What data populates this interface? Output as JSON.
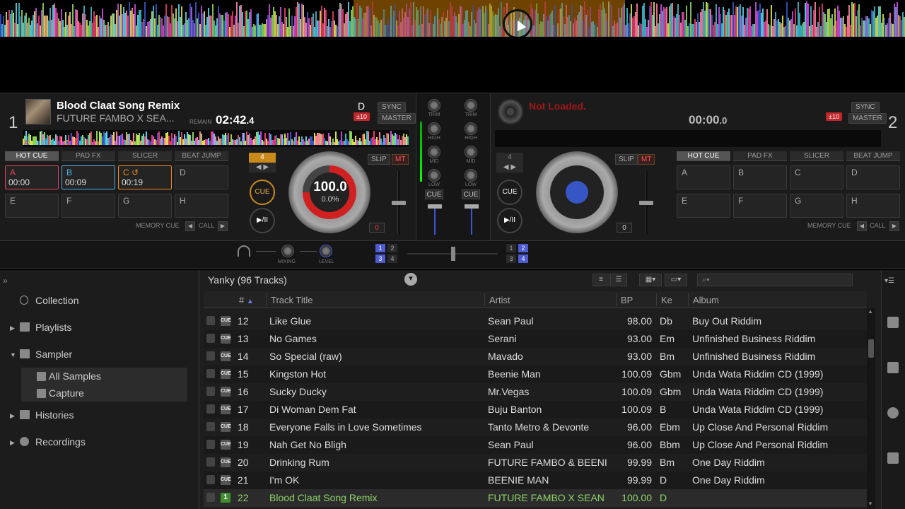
{
  "deck1": {
    "number": "1",
    "title": "Blood Claat Song Remix",
    "artist": "FUTURE FAMBO X SEA...",
    "remain_label": "REMAIN",
    "time_main": "02:42",
    "time_dec": ".4",
    "key": "D",
    "pitch_range": "±10",
    "sync_label": "SYNC",
    "master_label": "MASTER",
    "tabs": [
      "HOT CUE",
      "PAD FX",
      "SLICER",
      "BEAT JUMP"
    ],
    "pads": [
      {
        "label": "A",
        "time": "00:00",
        "color": "#e0455a"
      },
      {
        "label": "B",
        "time": "00:09",
        "color": "#4fb3e8"
      },
      {
        "label": "C ↺",
        "time": "00:19",
        "color": "#f08a1c"
      },
      {
        "label": "D",
        "time": ""
      },
      {
        "label": "E",
        "time": ""
      },
      {
        "label": "F",
        "time": ""
      },
      {
        "label": "G",
        "time": ""
      },
      {
        "label": "H",
        "time": ""
      }
    ],
    "memory_cue_label": "MEMORY CUE",
    "call_label": "CALL",
    "beat_count": "4",
    "cue_label": "CUE",
    "play_label": "▶/II",
    "bpm": "100.0",
    "pitch_percent": "0.0%",
    "slip_label": "SLIP",
    "mt_label": "MT",
    "pitch_zero": "0"
  },
  "deck2": {
    "number": "2",
    "title": "Not Loaded.",
    "time_main": "00:00",
    "time_dec": ".0",
    "pitch_range": "±10",
    "sync_label": "SYNC",
    "master_label": "MASTER",
    "tabs": [
      "HOT CUE",
      "PAD FX",
      "SLICER",
      "BEAT JUMP"
    ],
    "pads": [
      "A",
      "B",
      "C",
      "D",
      "E",
      "F",
      "G",
      "H"
    ],
    "memory_cue_label": "MEMORY CUE",
    "call_label": "CALL",
    "beat_count": "4",
    "cue_label": "CUE",
    "play_label": "▶/II",
    "slip_label": "SLIP",
    "mt_label": "MT",
    "pitch_zero": "0"
  },
  "mixer": {
    "knob_labels": [
      "TRIM",
      "HIGH",
      "MID",
      "LOW"
    ],
    "cue_label": "CUE",
    "mixing_label": "MIXING",
    "level_label": "LEVEL",
    "fx_left": [
      "1",
      "2",
      "3",
      "4"
    ],
    "fx_right": [
      "1",
      "2",
      "3",
      "4"
    ]
  },
  "browser": {
    "tree": {
      "collection": "Collection",
      "playlists": "Playlists",
      "sampler": "Sampler",
      "all_samples": "All Samples",
      "capture": "Capture",
      "histories": "Histories",
      "recordings": "Recordings"
    },
    "list_title": "Yanky (96 Tracks)",
    "columns": {
      "num": "#",
      "title": "Track Title",
      "artist": "Artist",
      "bpm": "BP",
      "key": "Ke",
      "album": "Album"
    },
    "rows": [
      {
        "num": "12",
        "title": "Like Glue",
        "artist": "Sean Paul",
        "bpm": "98.00",
        "key": "Db",
        "album": "Buy Out Riddim"
      },
      {
        "num": "13",
        "title": "No Games",
        "artist": "Serani",
        "bpm": "93.00",
        "key": "Em",
        "album": "Unfinished Business Riddim"
      },
      {
        "num": "14",
        "title": "So Special (raw)",
        "artist": "Mavado",
        "bpm": "93.00",
        "key": "Bm",
        "album": "Unfinished Business Riddim"
      },
      {
        "num": "15",
        "title": "Kingston Hot",
        "artist": "Beenie Man",
        "bpm": "100.09",
        "key": "Gbm",
        "album": "Unda Wata Riddim CD (1999)"
      },
      {
        "num": "16",
        "title": "Sucky Ducky",
        "artist": "Mr.Vegas",
        "bpm": "100.09",
        "key": "Gbm",
        "album": "Unda Wata Riddim CD (1999)"
      },
      {
        "num": "17",
        "title": "Di Woman Dem Fat",
        "artist": "Buju Banton",
        "bpm": "100.09",
        "key": "B",
        "album": "Unda Wata Riddim CD (1999)"
      },
      {
        "num": "18",
        "title": "Everyone Falls in Love Sometimes",
        "artist": "Tanto Metro & Devonte",
        "bpm": "96.00",
        "key": "Ebm",
        "album": "Up Close And Personal Riddim"
      },
      {
        "num": "19",
        "title": "Nah Get No Bligh",
        "artist": "Sean Paul",
        "bpm": "96.00",
        "key": "Bbm",
        "album": "Up Close And Personal Riddim"
      },
      {
        "num": "20",
        "title": "Drinking Rum",
        "artist": "FUTURE FAMBO & BEENI",
        "bpm": "99.99",
        "key": "Bm",
        "album": "One Day Riddim"
      },
      {
        "num": "21",
        "title": "I'm OK",
        "artist": "BEENIE MAN",
        "bpm": "99.99",
        "key": "D",
        "album": "One Day Riddim"
      },
      {
        "num": "22",
        "title": "Blood Claat Song Remix",
        "artist": "FUTURE FAMBO X SEAN",
        "bpm": "100.00",
        "key": "D",
        "album": "",
        "deck": "1"
      }
    ]
  },
  "colors": {
    "accent_blue": "#4e5bd0",
    "cue_red": "#c0262c",
    "playing_green": "#8fd46a"
  }
}
